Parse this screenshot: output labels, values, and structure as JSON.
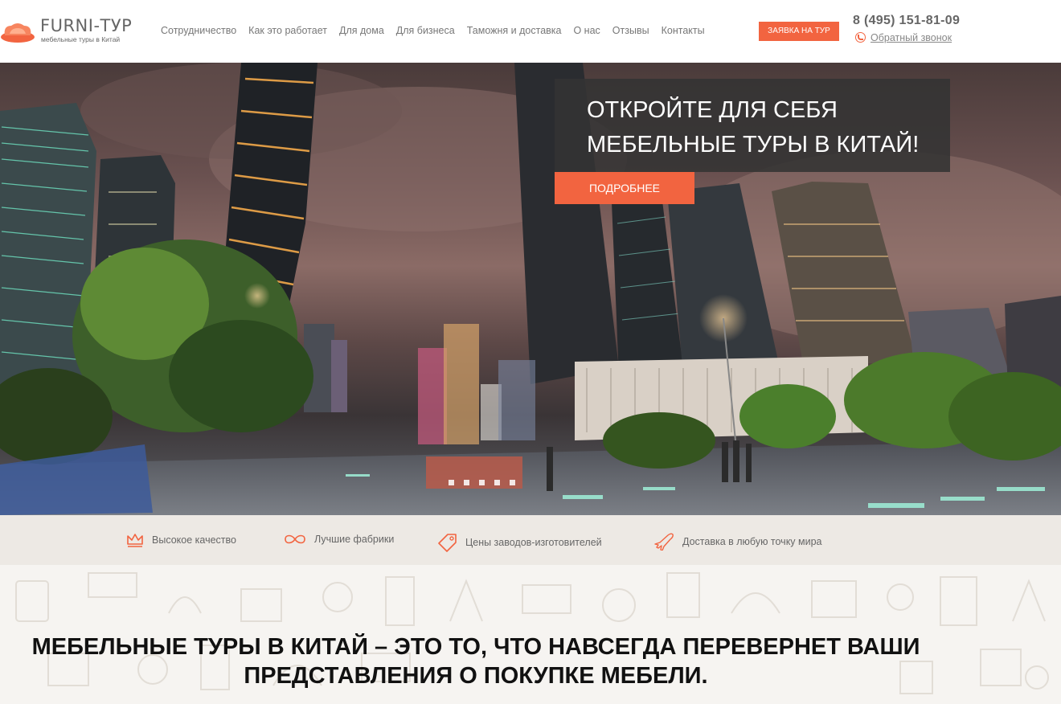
{
  "header": {
    "logo_title": "FURNI-ТУР",
    "logo_subtitle": "мебельные туры в Китай",
    "nav": [
      "Сотрудничество",
      "Как это работает",
      "Для дома",
      "Для бизнеса",
      "Таможня и доставка",
      "О нас",
      "Отзывы",
      "Контакты"
    ],
    "cta_label": "ЗАЯВКА НА ТУР",
    "phone": "8 (495) 151-81-09",
    "callback_label": "Обратный звонок"
  },
  "hero": {
    "title": "ОТКРОЙТЕ ДЛЯ СЕБЯ МЕБЕЛЬНЫЕ ТУРЫ В КИТАЙ!",
    "button_label": "ПОДРОБНЕЕ",
    "slide_count": 5
  },
  "features": [
    {
      "icon": "crown-icon",
      "label": "Высокое качество"
    },
    {
      "icon": "infinity-icon",
      "label": "Лучшие фабрики"
    },
    {
      "icon": "price-tag-icon",
      "label": "Цены заводов-изготовителей"
    },
    {
      "icon": "airplane-icon",
      "label": "Доставка в любую точку мира"
    }
  ],
  "section": {
    "title_line1": "МЕБЕЛЬНЫЕ ТУРЫ В КИТАЙ – ЭТО ТО, ЧТО НАВСЕГДА ПЕРЕВЕРНЕТ ВАШИ",
    "title_line2": "ПРЕДСТАВЛЕНИЯ О ПОКУПКЕ МЕБЕЛИ."
  },
  "colors": {
    "accent": "#f26440",
    "panel": "#333333",
    "features_bg": "#ede9e4"
  }
}
